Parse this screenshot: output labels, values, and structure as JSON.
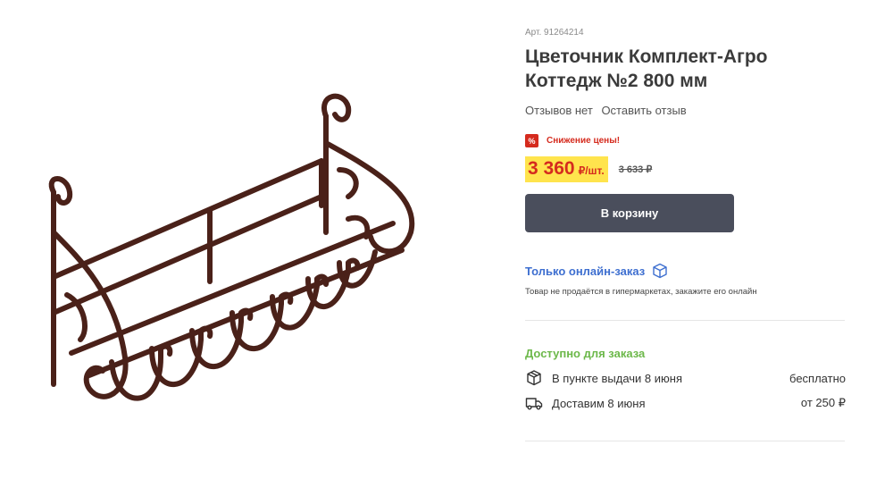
{
  "product": {
    "sku": "Арт. 91264214",
    "title": "Цветочник Комплект-Агро Коттедж №2 800 мм",
    "image_alt": "product-photo"
  },
  "reviews": {
    "none": "Отзывов нет",
    "leave": "Оставить отзыв"
  },
  "sale": {
    "icon": "%",
    "label": "Снижение цены!"
  },
  "price": {
    "current": "3 360",
    "unit": "₽/шт.",
    "old": "3 633 ₽"
  },
  "cart_button": "В корзину",
  "online": {
    "label": "Только онлайн-заказ",
    "note": "Товар не продаётся в гипермаркетах, закажите его онлайн"
  },
  "availability": {
    "title": "Доступно для заказа",
    "options": [
      {
        "icon": "box-icon",
        "label": "В пункте выдачи 8 июня",
        "price": "бесплатно"
      },
      {
        "icon": "truck-icon",
        "label": "Доставим 8 июня",
        "price": "от 250 ₽"
      }
    ]
  },
  "colors": {
    "accent_red": "#d52b1e",
    "price_highlight": "#ffe44d",
    "button": "#4a4e5c",
    "link_blue": "#3e6fd0",
    "available_green": "#6cb84a",
    "metal": "#4a2119"
  }
}
